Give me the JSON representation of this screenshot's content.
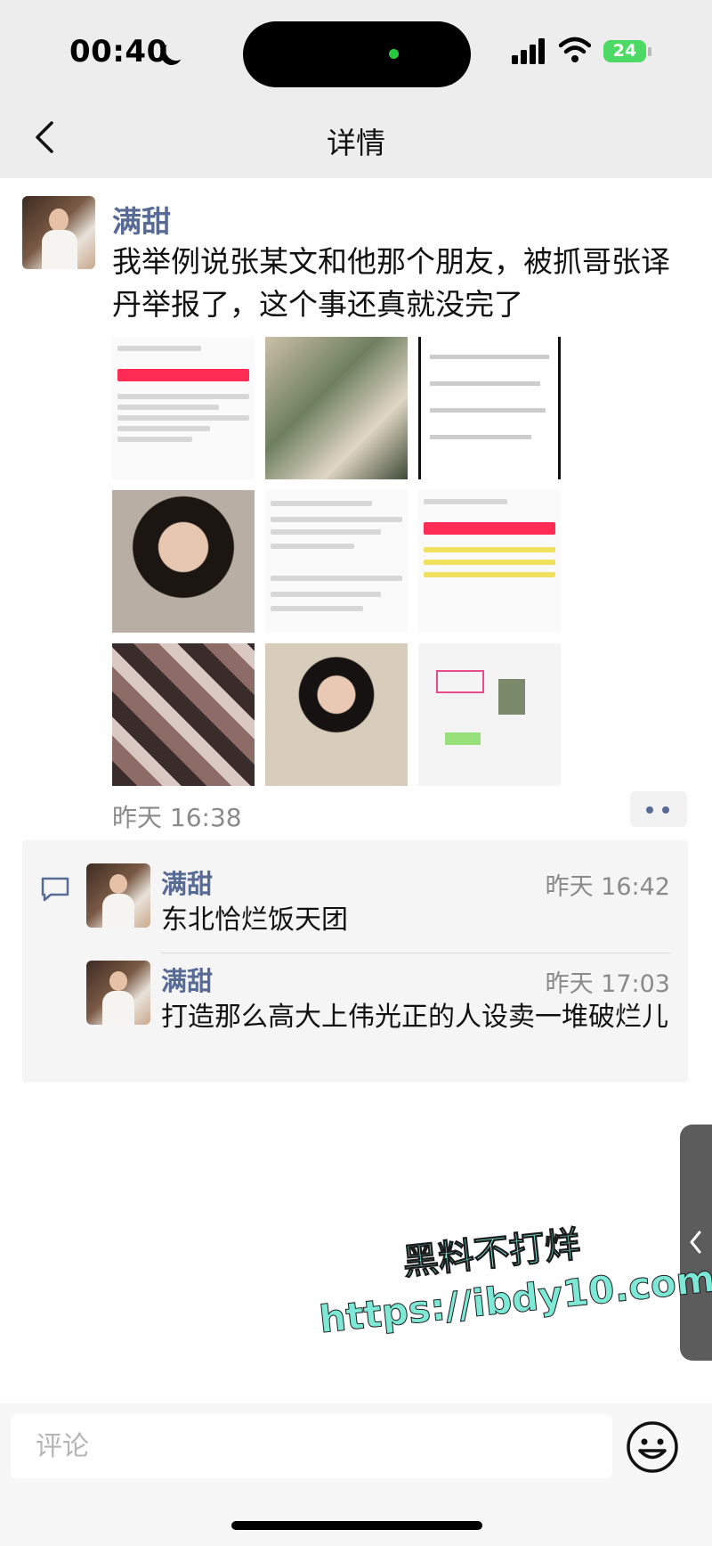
{
  "status_bar": {
    "time": "00:40",
    "battery": "24"
  },
  "nav": {
    "title": "详情"
  },
  "post": {
    "author": "满甜",
    "text": "我举例说张某文和他那个朋友，被抓哥张译丹举报了，这个事还真就没完了",
    "image_count": 9,
    "time": "昨天 16:38"
  },
  "comments": [
    {
      "author": "满甜",
      "time": "昨天 16:42",
      "text": "东北恰烂饭天团"
    },
    {
      "author": "满甜",
      "time": "昨天 17:03",
      "text": "打造那么高大上伟光正的人设卖一堆破烂儿"
    }
  ],
  "watermark": {
    "line1": "黑料不打烊",
    "line2": "https://ibdy10.com"
  },
  "comment_box": {
    "placeholder": "评论"
  },
  "colors": {
    "author": "#576b95",
    "background": "#ededed",
    "watermark": "#7ee8d6"
  }
}
